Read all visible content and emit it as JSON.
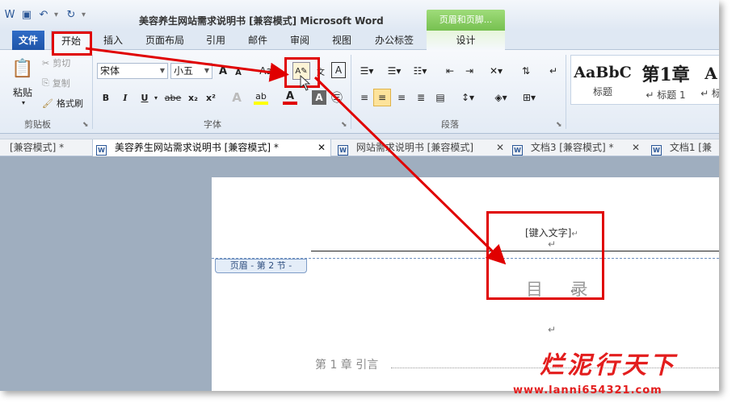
{
  "window": {
    "title": "美容养生网站需求说明书 [兼容模式] Microsoft Word",
    "contextual_group": "页眉和页脚..."
  },
  "qat": {
    "save_icon": "save-icon",
    "undo_icon": "undo-icon",
    "redo_icon": "redo-icon",
    "customize_icon": "customize-qat-icon"
  },
  "tabs": {
    "file": "文件",
    "items": [
      "开始",
      "插入",
      "页面布局",
      "引用",
      "邮件",
      "审阅",
      "视图",
      "办公标签",
      "设计"
    ]
  },
  "clipboard": {
    "paste": "粘贴",
    "cut": "剪切",
    "copy": "复制",
    "format_painter": "格式刷",
    "group": "剪贴板"
  },
  "font": {
    "name": "宋体",
    "size": "小五",
    "group": "字体",
    "buttons": [
      "B",
      "I",
      "U",
      "abe",
      "x₂",
      "x²"
    ],
    "font_color": "#e00000",
    "highlight_color": "#ffff00"
  },
  "paragraph": {
    "group": "段落"
  },
  "styles": {
    "items": [
      {
        "sample": "AaBbC",
        "name": "标题"
      },
      {
        "sample": "第1章",
        "name": "↵ 标题 1"
      },
      {
        "sample": "A",
        "name": "↵ 标"
      }
    ]
  },
  "doc_tabs": [
    {
      "label": "[兼容模式] *"
    },
    {
      "label": "美容养生网站需求说明书 [兼容模式] *"
    },
    {
      "label": "网站需求说明书 [兼容模式]"
    },
    {
      "label": "文档3 [兼容模式] *"
    },
    {
      "label": "文档1 [兼"
    }
  ],
  "document": {
    "header_placeholder": "[键入文字]",
    "header_tag": "页眉 - 第 2 节 -",
    "toc_title": "目  录",
    "chapter1": "第 1 章  引言"
  },
  "annotation_color": "#e00000",
  "watermark": {
    "line1": "烂泥行天下",
    "line2": "www.lanni654321.com"
  }
}
